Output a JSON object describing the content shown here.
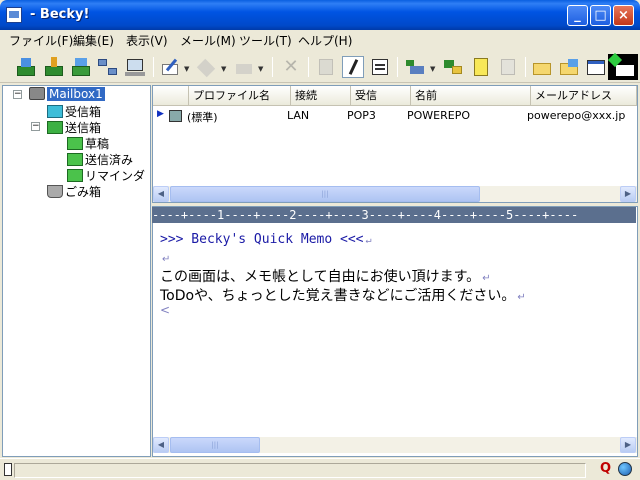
{
  "window": {
    "title": "- Becky!"
  },
  "menu": [
    {
      "label": "ファイル(F)"
    },
    {
      "label": "編集(E)"
    },
    {
      "label": "表示(V)"
    },
    {
      "label": "メール(M)"
    },
    {
      "label": "ツール(T)"
    },
    {
      "label": "ヘルプ(H)"
    }
  ],
  "toolbar": {
    "icons": [
      "receive-icon",
      "send-icon",
      "send-receive-icon",
      "network-icon",
      "computer-icon",
      "compose-icon",
      "reply-icon",
      "forward-icon",
      "delete-icon",
      "view-icon",
      "pen-icon",
      "properties-icon",
      "filter-icon",
      "filter-folder-icon",
      "memo-icon",
      "edit-icon",
      "folder-icon",
      "open-folder-icon",
      "window-icon"
    ]
  },
  "tree": {
    "root": "Mailbox1",
    "items": [
      {
        "label": "受信箱"
      },
      {
        "label": "送信箱"
      },
      {
        "label": "草稿"
      },
      {
        "label": "送信済み"
      },
      {
        "label": "リマインダ"
      },
      {
        "label": "ごみ箱"
      }
    ]
  },
  "list": {
    "columns": [
      "プロファイル名",
      "接続",
      "受信",
      "名前",
      "メールアドレス"
    ],
    "rows": [
      {
        "profile": "(標準)",
        "connection": "LAN",
        "receive": "POP3",
        "name": "POWEREPO",
        "email": "powerepo@xxx.jp"
      }
    ]
  },
  "memo": {
    "ruler": "----+----1----+----2----+----3----+----4----+----5----+----",
    "title": ">>> Becky's Quick Memo <<<",
    "line1": "この画面は、メモ帳として自由にお使い頂けます。",
    "line2": "ToDoや、ちょっとした覚え書きなどにご活用ください。",
    "line_end": "↵",
    "eof": "<"
  },
  "status": {
    "left": "",
    "right_q": "Q"
  },
  "colors": {
    "title_bar": "#0054e3",
    "selection": "#316ac5",
    "ruler_bg": "#5b6f8e",
    "memo_title": "#1a1aa6"
  }
}
